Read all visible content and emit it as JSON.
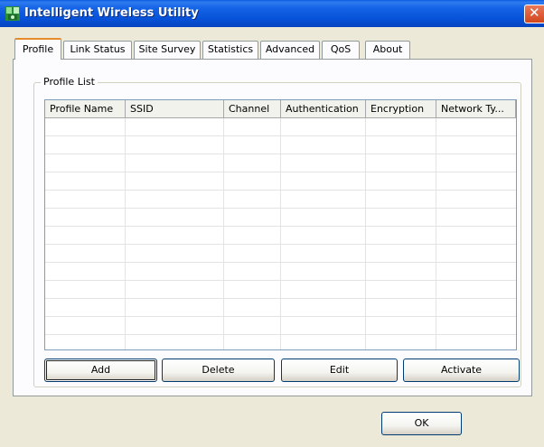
{
  "window": {
    "title": "Intelligent Wireless Utility"
  },
  "tabs": [
    {
      "label": "Profile",
      "active": true
    },
    {
      "label": "Link Status",
      "active": false
    },
    {
      "label": "Site Survey",
      "active": false
    },
    {
      "label": "Statistics",
      "active": false
    },
    {
      "label": "Advanced",
      "active": false
    },
    {
      "label": "QoS",
      "active": false
    },
    {
      "label": "About",
      "active": false
    }
  ],
  "profile_list": {
    "group_label": "Profile List",
    "columns": [
      "Profile Name",
      "SSID",
      "Channel",
      "Authentication",
      "Encryption",
      "Network Ty..."
    ],
    "rows": []
  },
  "buttons": {
    "add": "Add",
    "delete": "Delete",
    "edit": "Edit",
    "activate": "Activate",
    "ok": "OK"
  },
  "colors": {
    "titlebar": "#0652D8",
    "active_tab_highlight": "#E68B2C",
    "window_bg": "#ECE9D8"
  }
}
